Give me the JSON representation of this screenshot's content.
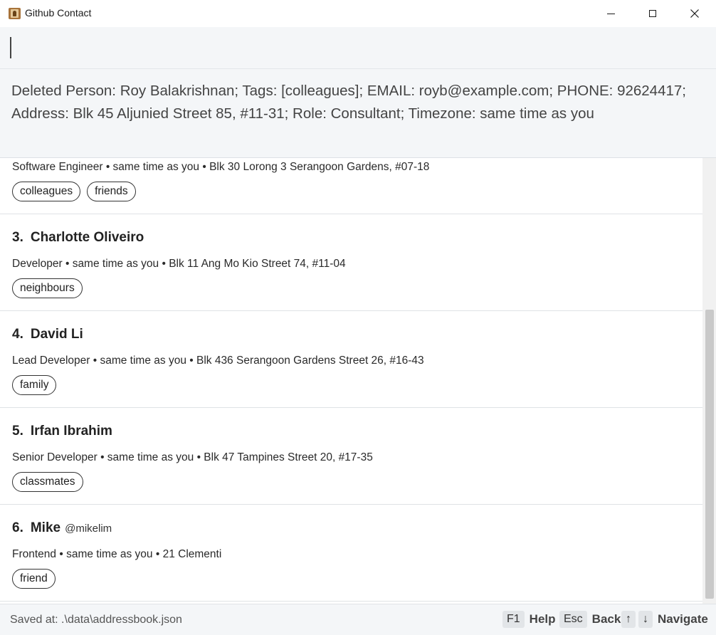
{
  "window": {
    "title": "Github Contact",
    "controls": {
      "minimize_icon": "minimize-icon",
      "maximize_icon": "maximize-icon",
      "close_glyph": "✕"
    }
  },
  "command_box": {
    "value": "",
    "placeholder": ""
  },
  "result_display": {
    "text": "Deleted Person: Roy Balakrishnan; Tags: [colleagues]; EMAIL: royb@example.com; PHONE: 92624417; Address: Blk 45 Aljunied Street 85, #11-31; Role: Consultant; Timezone: same time as you"
  },
  "person_list": {
    "cards": [
      {
        "index": "",
        "name": "",
        "handle": "",
        "details": "Software Engineer • same time as you • Blk 30 Lorong 3 Serangoon Gardens, #07-18",
        "tags": [
          "colleagues",
          "friends"
        ]
      },
      {
        "index": "3.",
        "name": "Charlotte Oliveiro",
        "handle": "",
        "details": "Developer • same time as you • Blk 11 Ang Mo Kio Street 74, #11-04",
        "tags": [
          "neighbours"
        ]
      },
      {
        "index": "4.",
        "name": "David Li",
        "handle": "",
        "details": "Lead Developer • same time as you • Blk 436 Serangoon Gardens Street 26, #16-43",
        "tags": [
          "family"
        ]
      },
      {
        "index": "5.",
        "name": "Irfan Ibrahim",
        "handle": "",
        "details": "Senior Developer • same time as you • Blk 47 Tampines Street 20, #17-35",
        "tags": [
          "classmates"
        ]
      },
      {
        "index": "6.",
        "name": "Mike",
        "handle": "@mikelim",
        "details": "Frontend • same time as you • 21 Clementi",
        "tags": [
          "friend"
        ]
      }
    ]
  },
  "status_bar": {
    "saved_text": "Saved at: .\\data\\addressbook.json",
    "hints": [
      {
        "keys": [
          "F1"
        ],
        "label": "Help"
      },
      {
        "keys": [
          "Esc"
        ],
        "label": "Back"
      },
      {
        "keys": [
          "↑",
          "↓"
        ],
        "label": "Navigate"
      }
    ]
  },
  "colors": {
    "panel_background": "#f4f6f8",
    "card_border": "#dfe2e5",
    "tag_border": "#333333",
    "key_background": "#e2e5e8"
  }
}
